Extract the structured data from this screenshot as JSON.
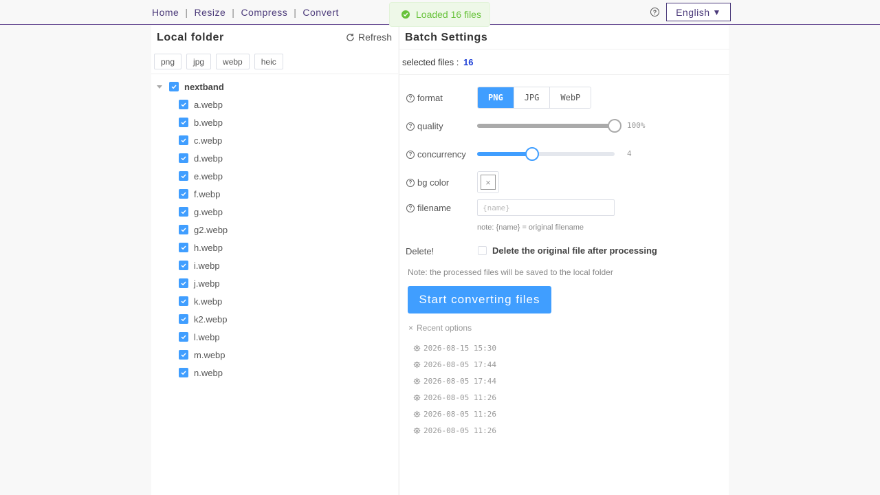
{
  "nav": {
    "items": [
      "Home",
      "Resize",
      "Compress",
      "Convert"
    ],
    "language": "English",
    "language_caret": "▼",
    "help_glyph": "?"
  },
  "toast": {
    "text": "Loaded 16 files",
    "icon": "check-icon",
    "color": "#67c23a"
  },
  "left": {
    "title": "Local folder",
    "refresh_label": "Refresh",
    "filters": [
      "png",
      "jpg",
      "webp",
      "heic"
    ],
    "root": "nextband",
    "files": [
      "a.webp",
      "b.webp",
      "c.webp",
      "d.webp",
      "e.webp",
      "f.webp",
      "g.webp",
      "g2.webp",
      "h.webp",
      "i.webp",
      "j.webp",
      "k.webp",
      "k2.webp",
      "l.webp",
      "m.webp",
      "n.webp"
    ]
  },
  "right": {
    "title": "Batch Settings",
    "selected_label": "selected files :",
    "selected_count": "16",
    "format": {
      "label": "format",
      "options": [
        "PNG",
        "JPG",
        "WebP"
      ],
      "selected": "PNG"
    },
    "quality": {
      "label": "quality",
      "value": 100,
      "display": "100%"
    },
    "concurrency": {
      "label": "concurrency",
      "value": 4,
      "max": 10,
      "display": "4"
    },
    "bg_color": {
      "label": "bg color",
      "value": "none",
      "glyph": "×"
    },
    "filename": {
      "label": "filename",
      "placeholder": "{name}",
      "note": "note: {name} = original filename"
    },
    "delete": {
      "label": "Delete!",
      "checkbox_label": "Delete the original file after processing",
      "checked": false
    },
    "save_note": "Note: the processed files will be saved to the local folder",
    "start_button": "Start converting files",
    "recent_label": "Recent options",
    "recent_glyph": "×",
    "recent": [
      "2026-08-15 15:30",
      "2026-08-05 17:44",
      "2026-08-05 17:44",
      "2026-08-05 11:26",
      "2026-08-05 11:26",
      "2026-08-05 11:26"
    ]
  },
  "colors": {
    "accent": "#409eff",
    "nav": "#4b3a7a",
    "count": "#1d3fd6"
  }
}
